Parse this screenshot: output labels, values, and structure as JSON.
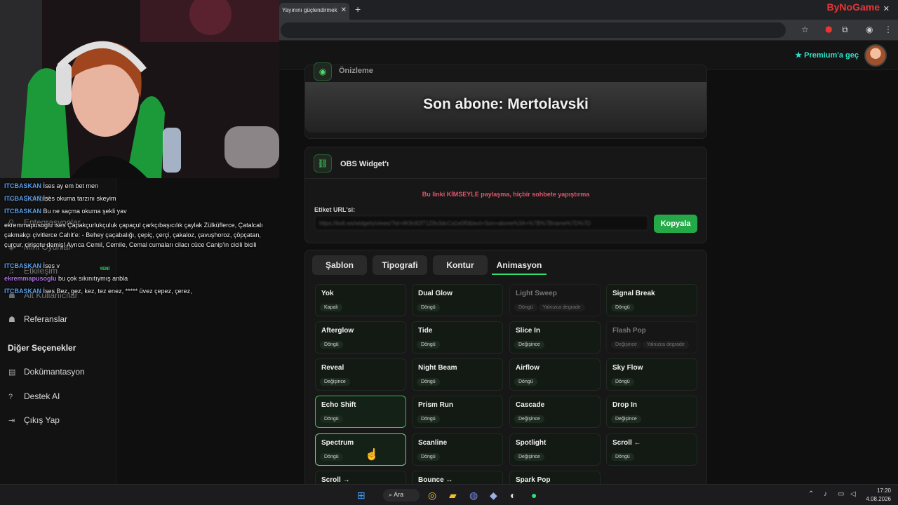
{
  "browser": {
    "tab_title": "Yayınını güçlendirmek",
    "brand": "ByNoGame"
  },
  "header": {
    "premium_label": "Premium'a geç"
  },
  "sidebar": {
    "items": [
      {
        "label": "Sohbet",
        "icon": "chat-icon"
      },
      {
        "label": "Entegrasyonlar",
        "icon": "plug-icon"
      },
      {
        "label": "Mini Oyunlar",
        "icon": "gamepad-icon"
      },
      {
        "label": "Etkileşim",
        "icon": "music-icon",
        "badge": "YENİ"
      },
      {
        "label": "Alt Kullanıcılar",
        "icon": "users-icon"
      },
      {
        "label": "Referanslar",
        "icon": "users-icon"
      }
    ],
    "other_heading": "Diğer Seçenekler",
    "other_items": [
      {
        "label": "Dokümantasyon",
        "icon": "book-icon"
      },
      {
        "label": "Destek AI",
        "icon": "help-icon"
      },
      {
        "label": "Çıkış Yap",
        "icon": "logout-icon"
      }
    ]
  },
  "preview": {
    "title": "Önizleme",
    "text": "Son abone: Mertolavski"
  },
  "obs": {
    "title": "OBS Widget'ı",
    "warning": "Bu linki KİMSEYLE paylaşma, hiçbir sohbete yapıştırma",
    "url_label": "Etiket URL'si:",
    "url_value": "https://bolt.ws/widgets/views/?id=4K9c82f71Z8x3dcCa1e0f0&text=Son+abone%3A+%7B%7Bname%7D%7D",
    "copy_label": "Kopyala"
  },
  "tabs": [
    "Şablon",
    "Tipografi",
    "Kontur",
    "Animasyon"
  ],
  "active_tab": "Animasyon",
  "animations": [
    {
      "name": "Yok",
      "badges": [
        "Kapalı"
      ],
      "state": "normal"
    },
    {
      "name": "Dual Glow",
      "badges": [
        "Döngü"
      ],
      "state": "normal"
    },
    {
      "name": "Light Sweep",
      "badges": [
        "Döngü",
        "Yalnızca degrade"
      ],
      "state": "disabled"
    },
    {
      "name": "Signal Break",
      "badges": [
        "Döngü"
      ],
      "state": "normal"
    },
    {
      "name": "Afterglow",
      "badges": [
        "Döngü"
      ],
      "state": "normal"
    },
    {
      "name": "Tide",
      "badges": [
        "Döngü"
      ],
      "state": "normal"
    },
    {
      "name": "Slice In",
      "badges": [
        "Değişince"
      ],
      "state": "normal"
    },
    {
      "name": "Flash Pop",
      "badges": [
        "Değişince",
        "Yalnızca degrade"
      ],
      "state": "disabled"
    },
    {
      "name": "Reveal",
      "badges": [
        "Değişince"
      ],
      "state": "normal"
    },
    {
      "name": "Night Beam",
      "badges": [
        "Döngü"
      ],
      "state": "normal"
    },
    {
      "name": "Airflow",
      "badges": [
        "Döngü"
      ],
      "state": "normal"
    },
    {
      "name": "Sky Flow",
      "badges": [
        "Döngü"
      ],
      "state": "normal"
    },
    {
      "name": "Echo Shift",
      "badges": [
        "Döngü"
      ],
      "state": "selected"
    },
    {
      "name": "Prism Run",
      "badges": [
        "Döngü"
      ],
      "state": "normal"
    },
    {
      "name": "Cascade",
      "badges": [
        "Değişince"
      ],
      "state": "normal"
    },
    {
      "name": "Drop In",
      "badges": [
        "Değişince"
      ],
      "state": "normal"
    },
    {
      "name": "Spectrum",
      "badges": [
        "Döngü"
      ],
      "state": "hover"
    },
    {
      "name": "Scanline",
      "badges": [
        "Döngü"
      ],
      "state": "normal"
    },
    {
      "name": "Spotlight",
      "badges": [
        "Değişince"
      ],
      "state": "normal"
    },
    {
      "name": "Scroll ←",
      "badges": [
        "Döngü"
      ],
      "state": "normal"
    },
    {
      "name": "Scroll →",
      "badges": [],
      "state": "normal"
    },
    {
      "name": "Bounce ↔",
      "badges": [],
      "state": "normal"
    },
    {
      "name": "Spark Pop",
      "badges": [],
      "state": "normal"
    }
  ],
  "chat": [
    {
      "user": "ITCBASKAN",
      "msg": "İses ay em bet men"
    },
    {
      "user": "ITCBASKAN",
      "msg": "İses okuma tarzını skeyim"
    },
    {
      "user": "ITCBASKAN",
      "msg": "Bu ne saçma okuma şekli yav"
    },
    {
      "user": "ekremmapusoglu",
      "msg": "ises Çapakçurlukçuluk çapaçul çarkçıbaşıcılık çaylak Zülküflerce, Çatalcalı çakmakçı çivitlerce Cahit'e: - Behey çaçabalığı, çepiç, çerçi, çakaloz, çavuşhoroz, çöpçatan, çurçur, çirişotu demiş! Ayrıca Cemil, Cemile, Cemal cumaları cilacı cüce Canip'in cicili bicili"
    },
    {
      "user": "ITCBASKAN",
      "msg": "İses v"
    },
    {
      "user": "ekremmapusoglu",
      "msg": "bu çok sıkınıtıymış anbla"
    },
    {
      "user": "ITCBASKAN",
      "msg": "İses Bez, gez, kez, tez enez, ***** üvez çepez, çerez,"
    }
  ],
  "taskbar": {
    "search_label": "Ara",
    "time": "17:20",
    "date": "4.08.2026"
  },
  "colors": {
    "accent": "#2ee070",
    "warning": "#e0566c",
    "copy_button": "#24a848",
    "premium": "#2ee0c8"
  }
}
